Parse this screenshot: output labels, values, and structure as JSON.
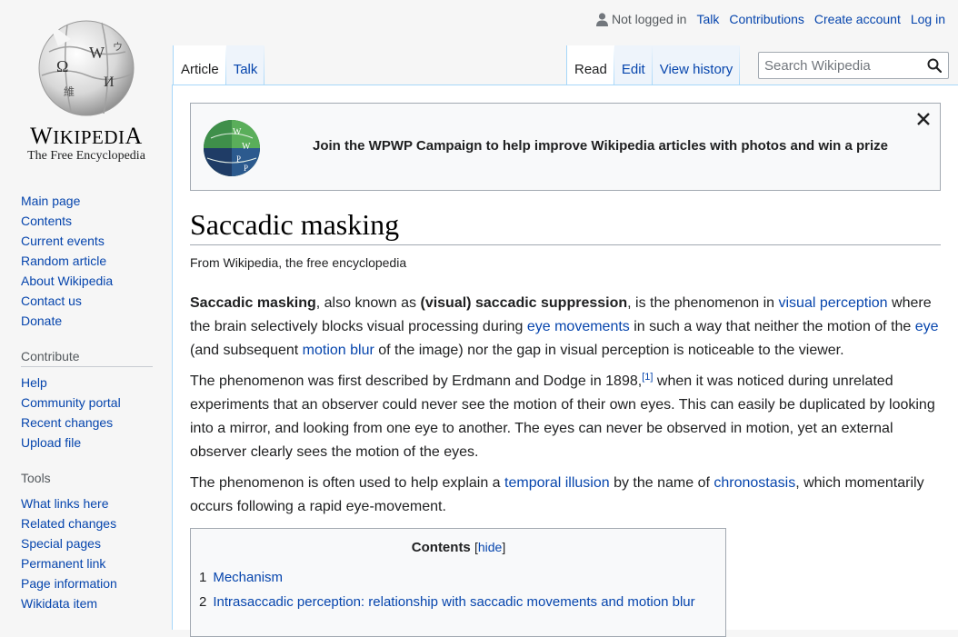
{
  "logo": {
    "wordmark": "Wikipedia",
    "wordmark_display": [
      "W",
      "IKIPEDI",
      "A"
    ],
    "tagline": "The Free Encyclopedia"
  },
  "sidebar": {
    "navigation": [
      "Main page",
      "Contents",
      "Current events",
      "Random article",
      "About Wikipedia",
      "Contact us",
      "Donate"
    ],
    "contribute": {
      "heading": "Contribute",
      "items": [
        "Help",
        "Community portal",
        "Recent changes",
        "Upload file"
      ]
    },
    "tools": {
      "heading": "Tools",
      "items": [
        "What links here",
        "Related changes",
        "Special pages",
        "Permanent link",
        "Page information",
        "Wikidata item"
      ]
    }
  },
  "personal": {
    "not_logged_in": "Not logged in",
    "talk": "Talk",
    "contributions": "Contributions",
    "create_account": "Create account",
    "log_in": "Log in"
  },
  "tabs": {
    "article": "Article",
    "talk": "Talk",
    "read": "Read",
    "edit": "Edit",
    "view_history": "View history"
  },
  "search": {
    "placeholder": "Search Wikipedia",
    "value": ""
  },
  "banner": {
    "text": "Join the WPWP Campaign to help improve Wikipedia articles with photos and win a prize"
  },
  "article": {
    "title": "Saccadic masking",
    "site_sub": "From Wikipedia, the free encyclopedia",
    "p1": {
      "b1": "Saccadic masking",
      "t1": ", also known as ",
      "b2": "(visual) saccadic suppression",
      "t2": ", is the phenomenon in ",
      "l1": "visual perception",
      "t3": " where the brain selectively blocks visual processing during ",
      "l2": "eye movements",
      "t4": " in such a way that neither the motion of the ",
      "l3": "eye",
      "t5": " (and subsequent ",
      "l4": "motion blur",
      "t6": " of the image) nor the gap in visual perception is noticeable to the viewer."
    },
    "p2": {
      "t1": "The phenomenon was first described by Erdmann and Dodge in 1898,",
      "ref": "[1]",
      "t2": " when it was noticed during unrelated experiments that an observer could never see the motion of their own eyes. This can easily be duplicated by looking into a mirror, and looking from one eye to another. The eyes can never be observed in motion, yet an external observer clearly sees the motion of the eyes."
    },
    "p3": {
      "t1": "The phenomenon is often used to help explain a ",
      "l1": "temporal illusion",
      "t2": " by the name of ",
      "l2": "chronostasis",
      "t3": ", which momentarily occurs following a rapid eye-movement."
    }
  },
  "toc": {
    "title": "Contents",
    "bracket_open": "[",
    "toggle": "hide",
    "bracket_close": "]",
    "items": [
      {
        "num": "1",
        "label": "Mechanism"
      },
      {
        "num": "2",
        "label": "Intrasaccadic perception: relationship with saccadic movements and motion blur"
      }
    ]
  }
}
